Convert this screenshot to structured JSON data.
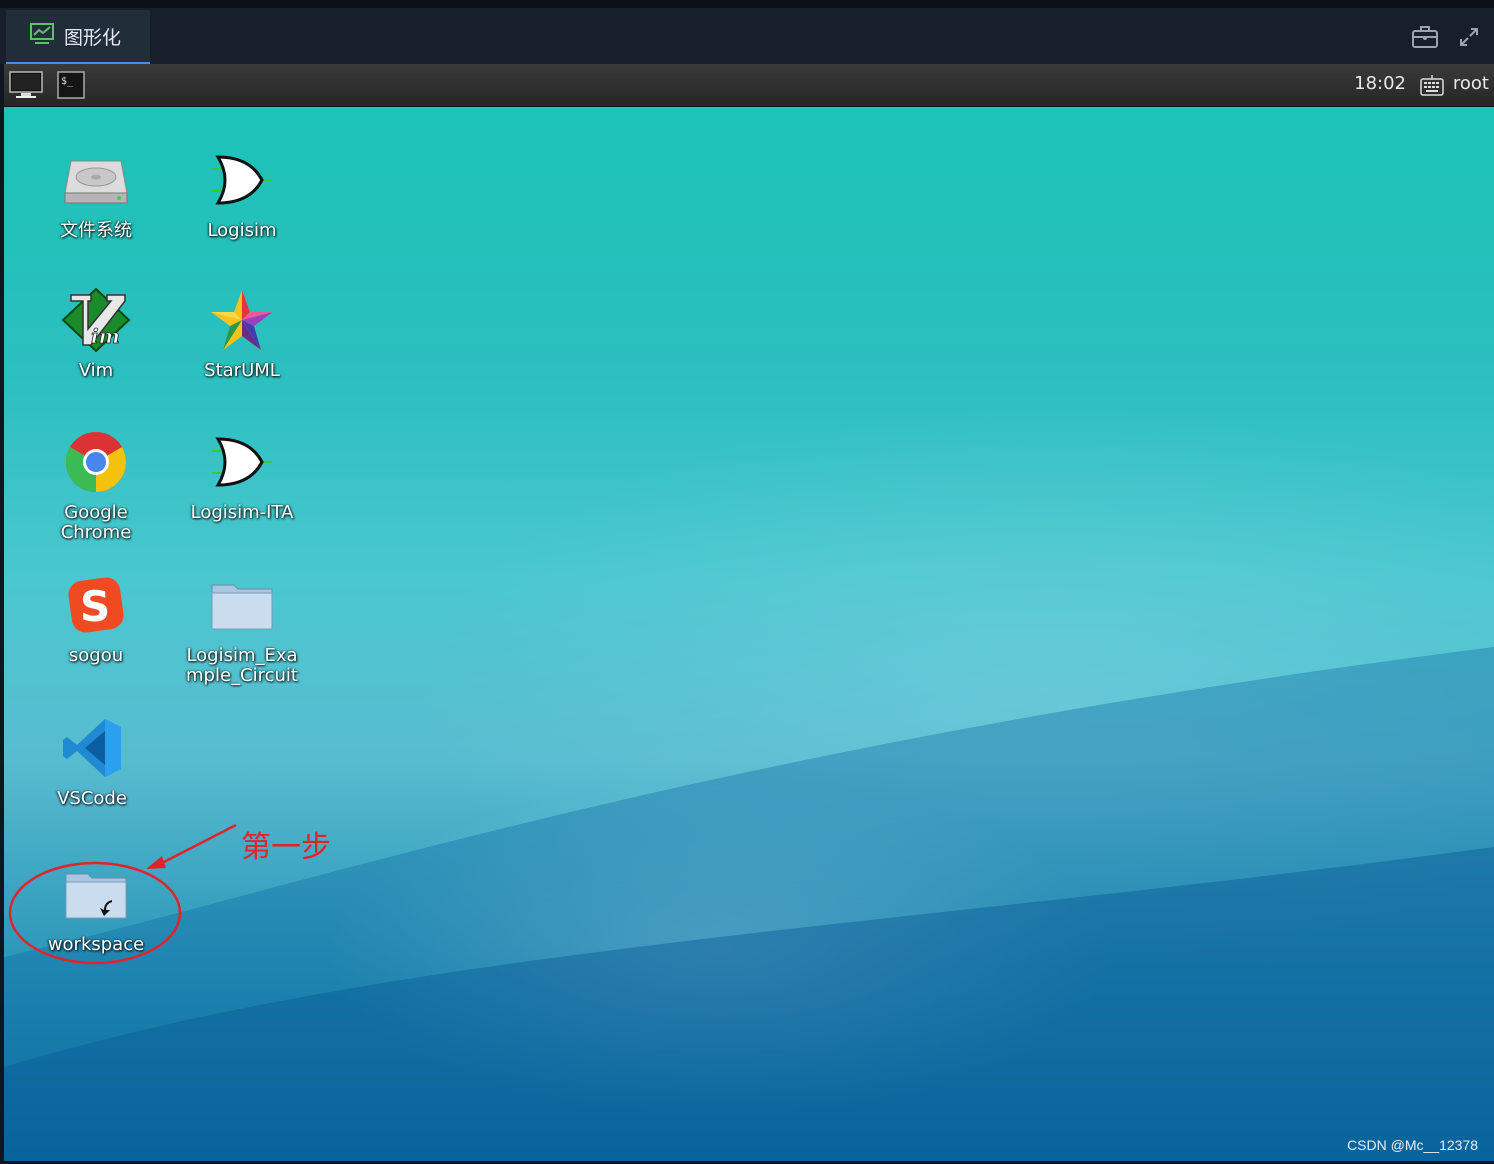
{
  "window": {
    "tab_label": "图形化",
    "tab_icon": "monitor-chart-icon",
    "top_right_icons": [
      "toolbox-icon",
      "fullscreen-icon"
    ]
  },
  "panel": {
    "launchers": [
      "display-icon",
      "terminal-icon"
    ],
    "clock": "18:02",
    "keyboard_icon": "keyboard-icon",
    "user": "root"
  },
  "desktop": {
    "icons": [
      {
        "label": "文件系统",
        "icon": "hard-drive-icon"
      },
      {
        "label": "Logisim",
        "icon": "or-gate-icon"
      },
      {
        "label": "Vim",
        "icon": "vim-icon"
      },
      {
        "label": "StarUML",
        "icon": "star-icon"
      },
      {
        "label": "Google\nChrome",
        "icon": "chrome-icon"
      },
      {
        "label": "Logisim-ITA",
        "icon": "or-gate-icon"
      },
      {
        "label": "sogou",
        "icon": "sogou-icon"
      },
      {
        "label": "Logisim_Exa\nmple_Circuit",
        "icon": "folder-icon"
      },
      {
        "label": "VSCode",
        "icon": "vscode-icon"
      },
      {
        "label": "workspace",
        "icon": "folder-link-icon"
      }
    ]
  },
  "annotation": {
    "text": "第一步",
    "color": "#e0232b"
  },
  "watermark": "CSDN @Mc__12378"
}
